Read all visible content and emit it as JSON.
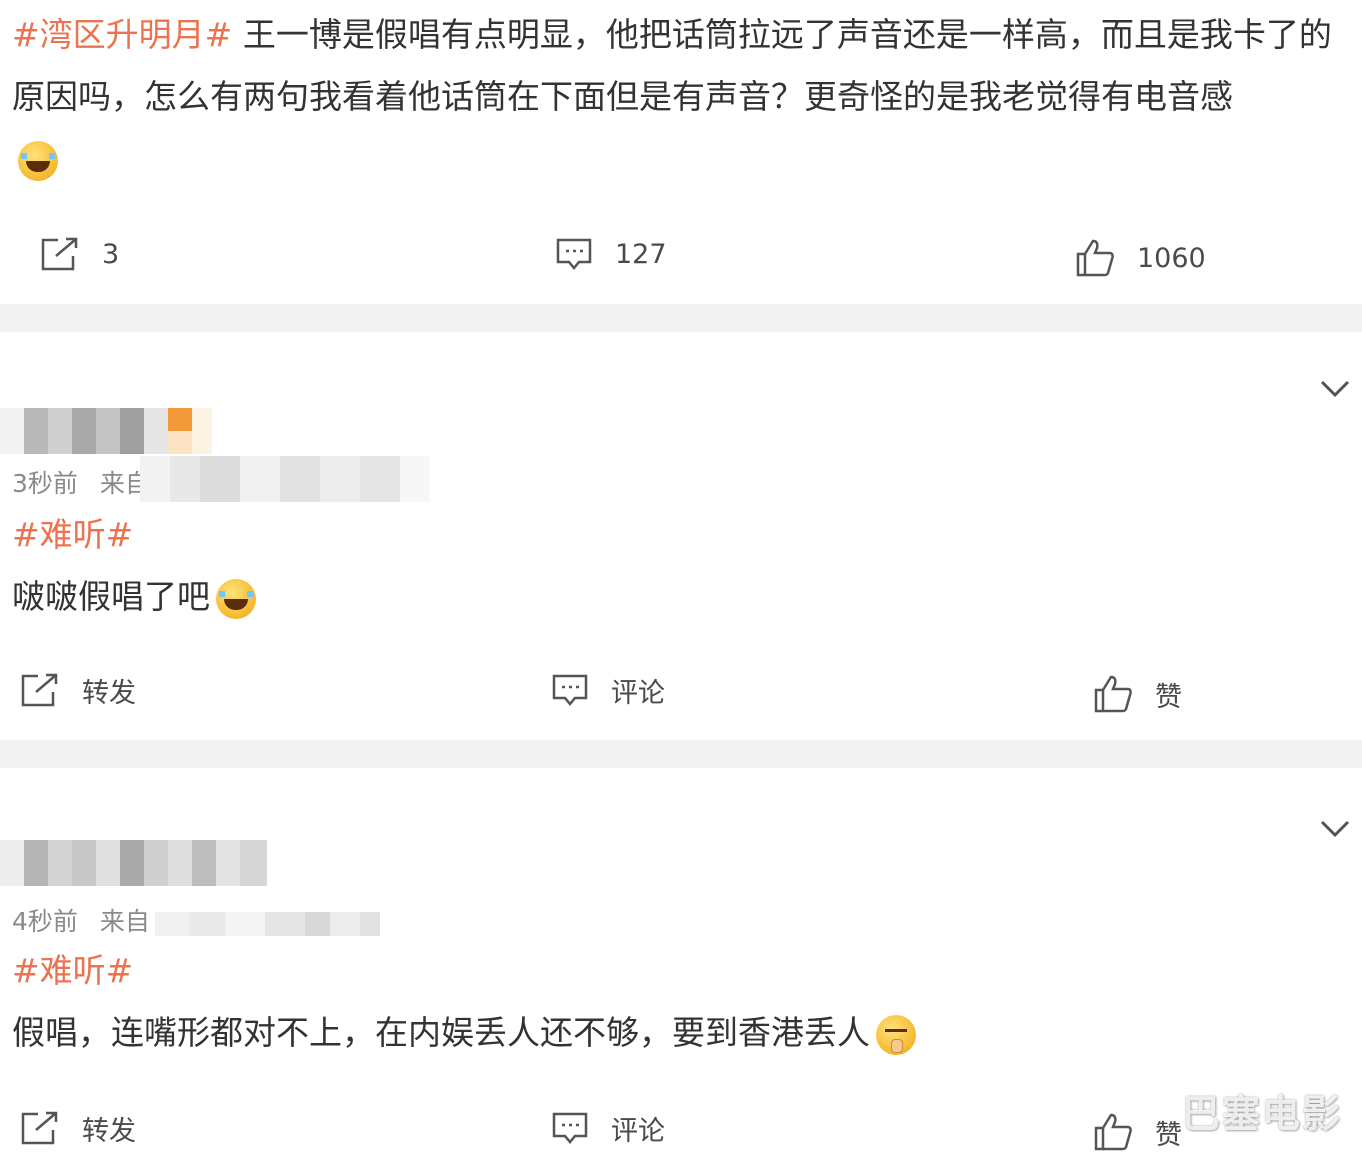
{
  "post1": {
    "topic": "#湾区升明月#",
    "text": "王一博是假唱有点明显，他把话筒拉远了声音还是一样高，而且是我卡了的原因吗，怎么有两句我看着他话筒在下面但是有声音？更奇怪的是我老觉得有电音感",
    "emoji": "laugh-cry-emoji",
    "actions": {
      "repost": "3",
      "comment": "127",
      "like": "1060"
    }
  },
  "post2": {
    "time": "3秒前",
    "source_prefix": "来自",
    "topic": "#难听#",
    "text": "啵啵假唱了吧",
    "emoji": "laugh-cry-emoji",
    "actions": {
      "repost": "转发",
      "comment": "评论",
      "like": "赞"
    }
  },
  "post3": {
    "time": "4秒前",
    "source_prefix": "来自",
    "topic": "#难听#",
    "text": "假唱，连嘴形都对不上，在内娱丢人还不够，要到香港丢人",
    "emoji": "shush-emoji",
    "actions": {
      "repost": "转发",
      "comment": "评论",
      "like": "赞"
    }
  },
  "watermark": "巴塞电影",
  "colors": {
    "topic": "#eb7350",
    "text": "#333333",
    "meta": "#8a8a8a",
    "separator": "#f2f2f2"
  }
}
